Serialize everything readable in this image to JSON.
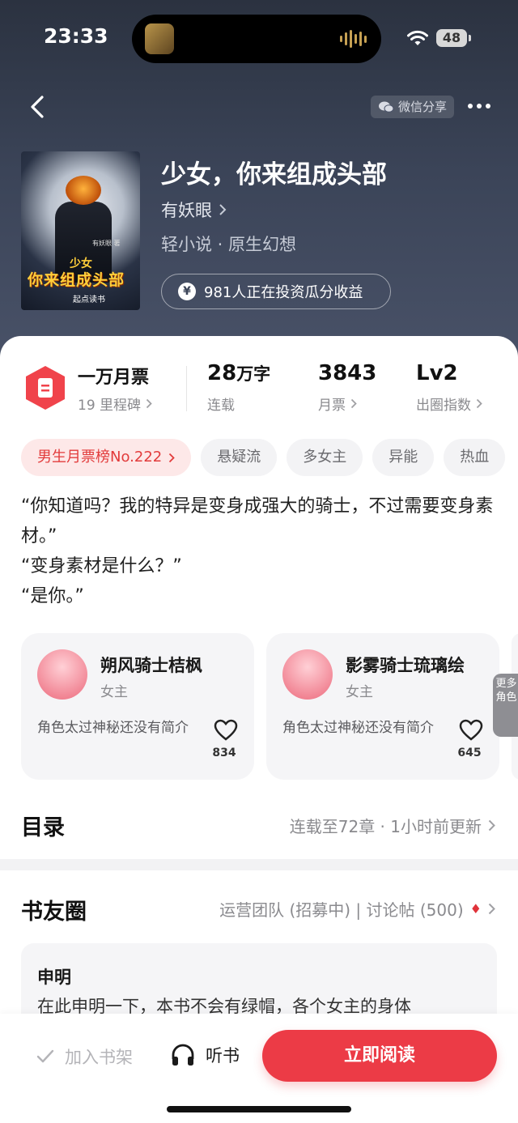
{
  "status_bar": {
    "time": "23:33",
    "battery": "48"
  },
  "header": {
    "share_label": "微信分享"
  },
  "book": {
    "title": "少女，你来组成头部",
    "author": "有妖眼",
    "genre": "轻小说 · 原生幻想",
    "invest_text": "981人正在投资瓜分收益",
    "cover": {
      "author_small": "有妖眼 著",
      "title_line1": "少女",
      "title_line2": "你来组成头部",
      "brand": "起点读书"
    }
  },
  "stats": {
    "monthly_ticket": {
      "value": "一万月票",
      "sub": "19 里程碑"
    },
    "words": {
      "value": "28",
      "unit": "万字",
      "sub": "连载"
    },
    "tickets": {
      "value": "3843",
      "sub": "月票"
    },
    "level": {
      "value": "Lv2",
      "sub": "出圈指数"
    }
  },
  "tags": [
    "男生月票榜No.222",
    "悬疑流",
    "多女主",
    "异能",
    "热血"
  ],
  "synopsis": [
    "“你知道吗？我的特异是变身成强大的骑士，不过需要变身素材。”",
    "“变身素材是什么？”",
    "“是你。”"
  ],
  "roles": [
    {
      "name": "朔风骑士桔枫",
      "type": "女主",
      "desc": "角色太过神秘还没有简介",
      "likes": "834"
    },
    {
      "name": "影雾骑士琉璃绘",
      "type": "女主",
      "desc": "角色太过神秘还没有简介",
      "likes": "645"
    }
  ],
  "more_roles_label": "更多角色",
  "toc": {
    "title": "目录",
    "info": "连载至72章 · 1小时前更新"
  },
  "club": {
    "title": "书友圈",
    "info": "运营团队 (招募中) | 讨论帖 (500)",
    "post_title": "申明",
    "post_body": "在此申明一下，本书不会有绿帽，各个女主的身体"
  },
  "bottom": {
    "shelf": "加入书架",
    "listen": "听书",
    "read": "立即阅读"
  },
  "colors": {
    "accent": "#ec3b46",
    "hero_bg": "#3b4458"
  }
}
